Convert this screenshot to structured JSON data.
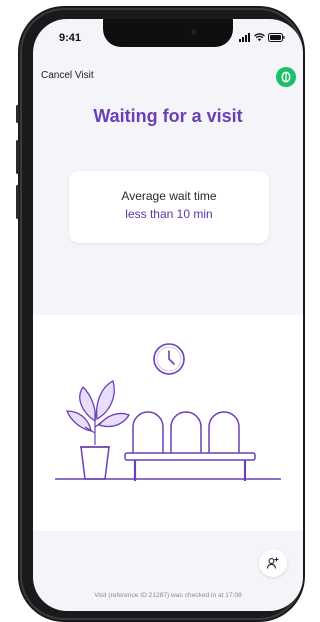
{
  "status_bar": {
    "time": "9:41",
    "icons": [
      "signal-icon",
      "wifi-icon",
      "battery-icon"
    ]
  },
  "header": {
    "cancel_label": "Cancel Visit",
    "app_button_icon": "app-logo-icon"
  },
  "main": {
    "title": "Waiting for a visit",
    "wait_card": {
      "label": "Average wait time",
      "value": "less than 10 min"
    },
    "illustration": {
      "icons": [
        "clock-icon",
        "potted-plant-icon",
        "waiting-bench-icon"
      ]
    }
  },
  "actions": {
    "add_person_icon": "add-person-icon"
  },
  "footer": {
    "text": "Visit (reference ID 21287) was checked in at 17:08"
  },
  "colors": {
    "accent": "#6a3fb8",
    "app_green": "#19c069",
    "background": "#f4f4f9"
  }
}
